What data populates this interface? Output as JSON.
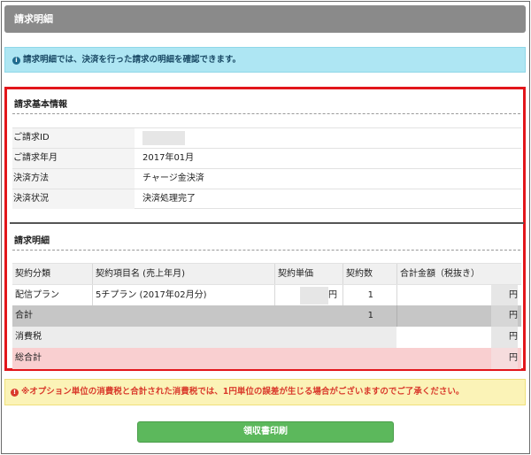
{
  "header": {
    "title": "請求明細"
  },
  "info": {
    "icon": "info-circle-icon",
    "text": "請求明細では、決済を行った請求の明細を確認できます。"
  },
  "basic": {
    "title": "請求基本情報",
    "rows": [
      {
        "label": "ご請求ID",
        "value": ""
      },
      {
        "label": "ご請求年月",
        "value": "2017年01月"
      },
      {
        "label": "決済方法",
        "value": "チャージ金決済"
      },
      {
        "label": "決済状況",
        "value": "決済処理完了"
      }
    ]
  },
  "details": {
    "title": "請求明細",
    "headers": [
      "契約分類",
      "契約項目名 (売上年月)",
      "契約単価",
      "契約数",
      "合計金額（税抜き）"
    ],
    "item": {
      "category": "配信プラン",
      "name": "5チプラン (2017年02月分)",
      "unit_price_suffix": "円",
      "quantity": "1",
      "total_suffix": "円"
    },
    "subtotal": {
      "label": "合計",
      "quantity": "1",
      "total_suffix": "円"
    },
    "tax": {
      "label": "消費税",
      "total_suffix": "円"
    },
    "grand": {
      "label": "総合計",
      "total_suffix": "円"
    }
  },
  "warning": {
    "icon": "alert-circle-icon",
    "text": "※オプション単位の消費税と合計された消費税では、1円単位の誤差が生じる場合がございますのでご了承ください。"
  },
  "print_button": {
    "label": "領収書印刷"
  },
  "colors": {
    "accent_red": "#e2161b",
    "button_green": "#5cb85c",
    "info_blue": "#aee6f3",
    "warning_yellow": "#fbf3b7"
  }
}
